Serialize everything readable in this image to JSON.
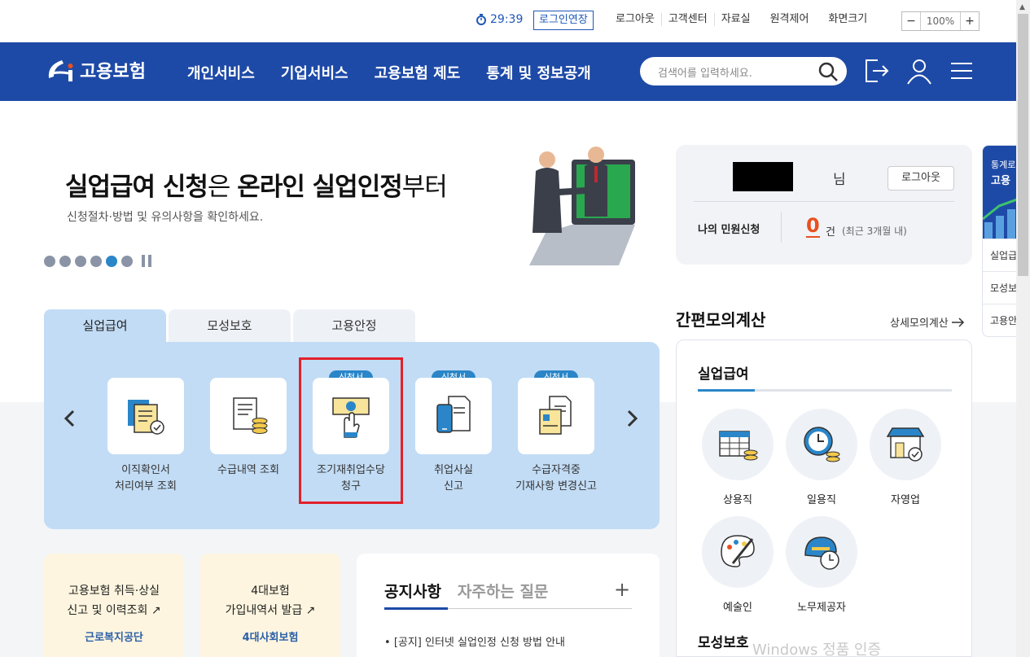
{
  "util": {
    "timer": "29:39",
    "extend": "로그인연장",
    "links": [
      "로그아웃",
      "고객센터",
      "자료실",
      "원격제어"
    ],
    "zoom_label": "화면크기",
    "zoom_minus": "−",
    "zoom_value": "100%",
    "zoom_plus": "+"
  },
  "header": {
    "logo": "고용보험",
    "nav": [
      "개인서비스",
      "기업서비스",
      "고용보험 제도",
      "통계 및 정보공개"
    ],
    "search_placeholder": "검색어를 입력하세요."
  },
  "banner": {
    "title_bold1": "실업급여 신청",
    "title_light1": "은 ",
    "title_bold2": "온라인 실업인정",
    "title_light2": "부터",
    "subtitle": "신청절차·방법 및 유의사항을 확인하세요.",
    "slide_count": 6,
    "active_slide": 5
  },
  "tabs": [
    "실업급여",
    "모성보호",
    "고용안정"
  ],
  "services": [
    {
      "label1": "이직확인서",
      "label2": "처리여부 조회",
      "badge": ""
    },
    {
      "label1": "수급내역 조회",
      "label2": "",
      "badge": ""
    },
    {
      "label1": "조기재취업수당",
      "label2": "청구",
      "badge": "신청서"
    },
    {
      "label1": "취업사실",
      "label2": "신고",
      "badge": "신청서"
    },
    {
      "label1": "수급자격중",
      "label2": "기재사항 변경신고",
      "badge": "신청서"
    }
  ],
  "quick_cards": [
    {
      "line1": "고용보험 취득·상실",
      "line2": "신고 및 이력조회 ↗",
      "org": "근로복지공단"
    },
    {
      "line1": "4대보험",
      "line2": "가입내역서 발급 ↗",
      "org": "4대사회보험"
    }
  ],
  "notice": {
    "tab1": "공지사항",
    "tab2": "자주하는 질문",
    "plus": "+",
    "item1": "[공지] 인터넷 실업인정 신청 방법 안내"
  },
  "user": {
    "suffix": "님",
    "logout": "로그아웃",
    "req_label": "나의 민원신청",
    "count": "0",
    "unit": "건",
    "note": "(최근 3개월 내)"
  },
  "calc": {
    "title": "간편모의계산",
    "more": "상세모의계산",
    "section1": "실업급여",
    "cats": [
      "상용직",
      "일용직",
      "자영업",
      "예술인",
      "노무제공자"
    ],
    "section2": "모성보호"
  },
  "side": {
    "head1": "통계로",
    "head2": "고용",
    "items": [
      "실업급",
      "모성보",
      "고용안"
    ]
  },
  "watermark": "Windows 정품 인증",
  "colors": {
    "brand": "#1e4aa7",
    "accent": "#2a86c8",
    "alert": "#e8501e",
    "highlight": "#e2202a"
  }
}
